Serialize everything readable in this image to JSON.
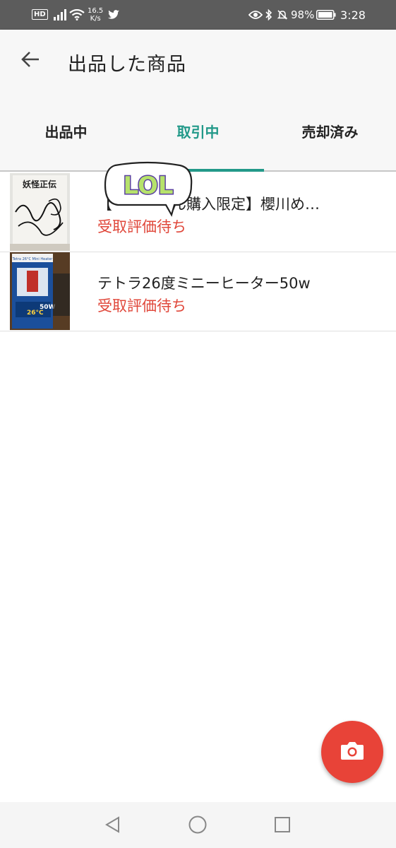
{
  "status_bar": {
    "hd": "HD",
    "speed_value": "16.5",
    "speed_unit": "K/s",
    "battery_percent": "98%",
    "time": "3:28",
    "icons": [
      "signal-icon",
      "wifi-icon",
      "twitter-icon",
      "eye-icon",
      "bluetooth-icon",
      "mute-icon",
      "battery-icon"
    ]
  },
  "app_bar": {
    "title": "出品した商品",
    "back_icon": "arrow-left-icon"
  },
  "tabs": [
    {
      "label": "出品中",
      "active": false
    },
    {
      "label": "取引中",
      "active": true
    },
    {
      "label": "売却済み",
      "active": false
    }
  ],
  "items": [
    {
      "title": "【　　　　ん購入限定】櫻川め…",
      "status": "受取評価待ち",
      "thumb_text": [
        "妖怪正伝"
      ]
    },
    {
      "title": "テトラ26度ミニーヒーター50w",
      "status": "受取評価待ち",
      "thumb_text": [
        "Tetra 26°C Mini Heater",
        "26°C",
        "50W"
      ]
    }
  ],
  "sticker": {
    "text": "LOL"
  },
  "fab": {
    "icon": "camera-icon"
  },
  "nav": {
    "icons": [
      "back-triangle-icon",
      "home-circle-icon",
      "recents-square-icon"
    ]
  },
  "colors": {
    "accent": "#229989",
    "status_red": "#e0473a",
    "fab": "#e84338"
  }
}
